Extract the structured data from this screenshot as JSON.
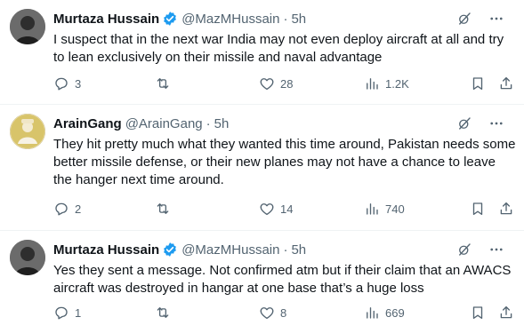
{
  "colors": {
    "verified": "#1d9bf0",
    "text": "#0f1419",
    "muted": "#536471",
    "divider": "#eff3f4"
  },
  "tweets": [
    {
      "author": "Murtaza Hussain",
      "verified": true,
      "handle": "@MazMHussain",
      "time": "5h",
      "text": "I suspect that in the next war India may not even deploy aircraft at all and try to lean exclusively on their missile and naval advantage",
      "replies": "3",
      "retweets": "",
      "likes": "28",
      "views": "1.2K"
    },
    {
      "author": "ArainGang",
      "verified": false,
      "handle": "@ArainGang",
      "time": "5h",
      "text": "They hit pretty much what they wanted this time around, Pakistan needs some better missile defense, or their new planes may not have a chance to leave the hanger next time around.",
      "replies": "2",
      "retweets": "",
      "likes": "14",
      "views": "740"
    },
    {
      "author": "Murtaza Hussain",
      "verified": true,
      "handle": "@MazMHussain",
      "time": "5h",
      "text": "Yes they sent a message. Not confirmed atm but if their claim that an AWACS aircraft was destroyed in hangar at one base that’s a huge loss",
      "replies": "1",
      "retweets": "",
      "likes": "8",
      "views": "669"
    }
  ],
  "separator": "·"
}
